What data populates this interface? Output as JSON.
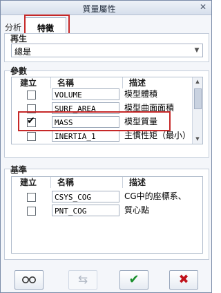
{
  "window": {
    "title": "質量屬性"
  },
  "tabs": [
    {
      "label": "分析"
    },
    {
      "label": "特徵"
    }
  ],
  "regen": {
    "title": "再生",
    "selected": "總是"
  },
  "params": {
    "title": "參數",
    "columns": [
      "建立",
      "名稱",
      "描述"
    ],
    "rows": [
      {
        "name": "VOLUME",
        "desc": "模型體積",
        "checked": false
      },
      {
        "name": "SURF_AREA",
        "desc": "模型曲面面積",
        "checked": false
      },
      {
        "name": "MASS",
        "desc": "模型質量",
        "checked": true
      },
      {
        "name": "INERTIA_1",
        "desc": "主慣性矩（最小）",
        "checked": false
      }
    ]
  },
  "datums": {
    "title": "基準",
    "columns": [
      "建立",
      "名稱",
      "描述"
    ],
    "rows": [
      {
        "name": "CSYS_COG",
        "desc": "CG中的座標系、",
        "checked": false
      },
      {
        "name": "PNT_COG",
        "desc": "質心點",
        "checked": false
      }
    ]
  },
  "footer": {
    "icons": [
      "glasses-icon",
      "repeat-icon",
      "checkmark-icon",
      "cancel-x-icon"
    ],
    "colors": {
      "ok": "#1a8f2c",
      "cancel": "#c0121b"
    }
  }
}
